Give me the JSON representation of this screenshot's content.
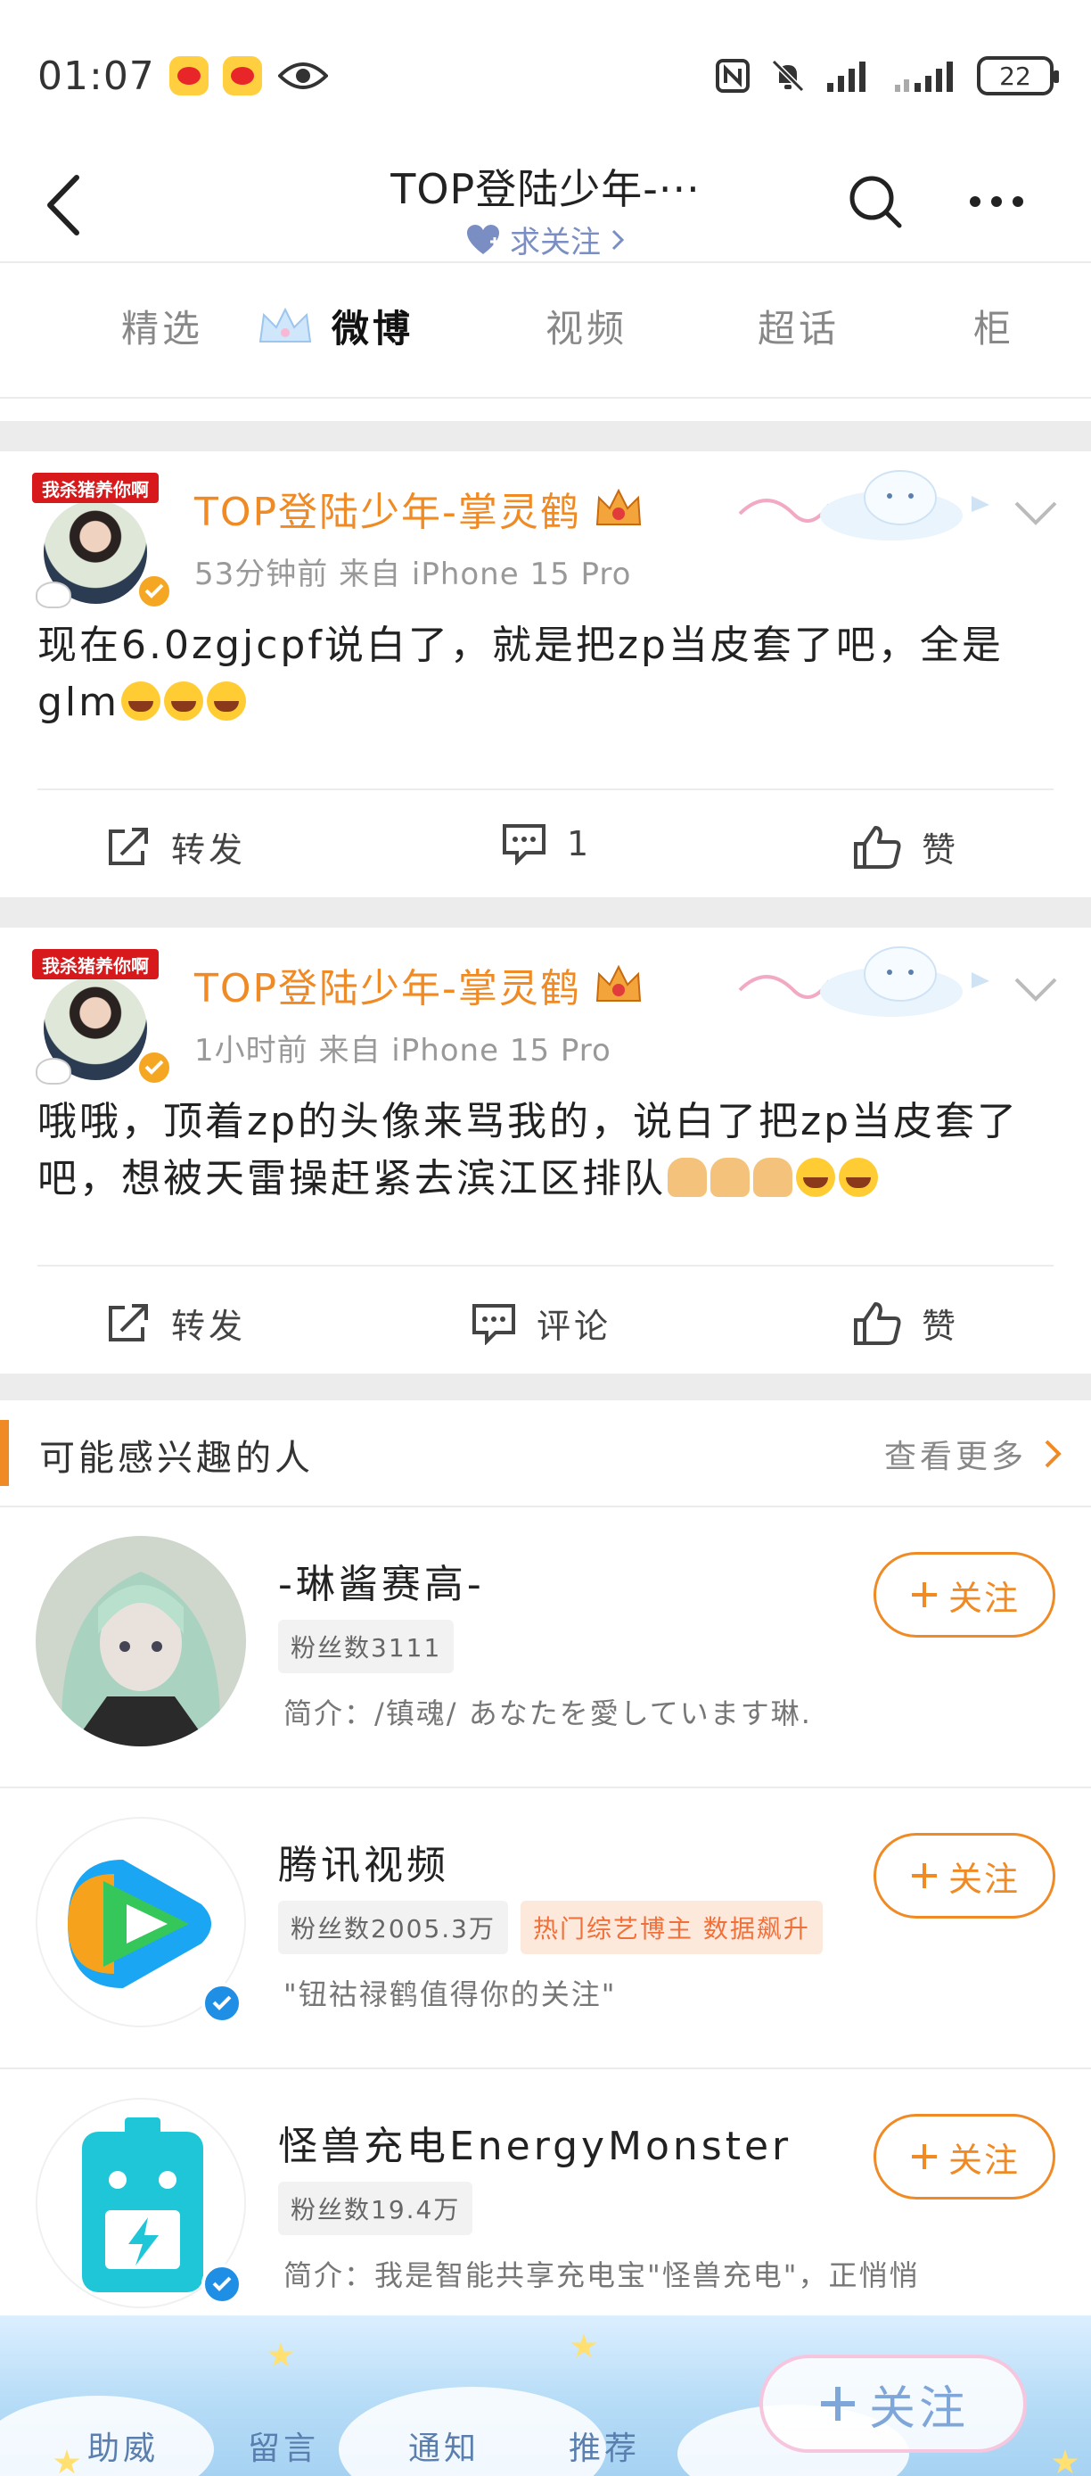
{
  "status_bar": {
    "time": "01:07",
    "battery": "22"
  },
  "nav": {
    "title": "TOP登陆少年-···",
    "follow_hint": "求关注"
  },
  "tabs": [
    {
      "label": "精选"
    },
    {
      "label": "微博"
    },
    {
      "label": "视频"
    },
    {
      "label": "超话"
    },
    {
      "label": "柜"
    }
  ],
  "posts": [
    {
      "avatar_banner": "我杀猪养你啊",
      "author": "TOP登陆少年-掌灵鹤",
      "meta": "53分钟前 来自 iPhone 15 Pro",
      "text": "现在6.0zgjcpf说白了，就是把zp当皮套了吧，全是glm",
      "actions": {
        "repost": "转发",
        "comment": "1",
        "like": "赞"
      }
    },
    {
      "avatar_banner": "我杀猪养你啊",
      "author": "TOP登陆少年-掌灵鹤",
      "meta": "1小时前 来自 iPhone 15 Pro",
      "text": "哦哦，顶着zp的头像来骂我的，说白了把zp当皮套了吧，想被天雷操赶紧去滨江区排队",
      "actions": {
        "repost": "转发",
        "comment": "评论",
        "like": "赞"
      }
    }
  ],
  "suggestions": {
    "title": "可能感兴趣的人",
    "see_more": "查看更多",
    "follow_label": "关注",
    "items": [
      {
        "name": "-琳酱赛高-",
        "tags": [
          "粉丝数3111"
        ],
        "bio": "简介：/镇魂/ あなたを愛しています琳."
      },
      {
        "name": "腾讯视频",
        "tags": [
          "粉丝数2005.3万",
          "热门综艺博主 数据飙升"
        ],
        "bio": "\"钮祜禄鹤值得你的关注\""
      },
      {
        "name": "怪兽充电EnergyMonster",
        "tags": [
          "粉丝数19.4万"
        ],
        "bio": "简介：我是智能共享充电宝\"怪兽充电\"，正悄悄"
      }
    ]
  },
  "bottom_bar": {
    "items": [
      "助威",
      "留言",
      "通知",
      "推荐"
    ],
    "follow_label": "关注"
  },
  "colors": {
    "accent": "#f08a24",
    "verified": "#1f8fe6",
    "muted": "#999999"
  }
}
